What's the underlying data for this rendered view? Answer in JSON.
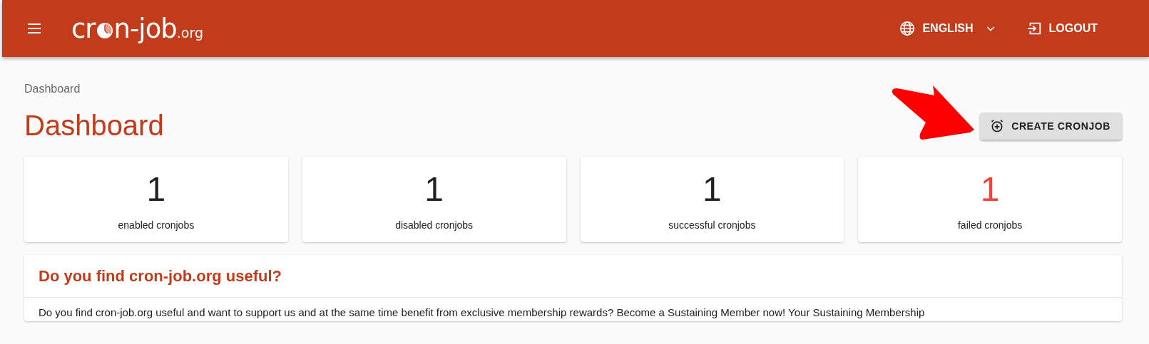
{
  "header": {
    "logo": {
      "main": "cr",
      "rest": "n-job",
      "suffix": ".org"
    },
    "language": "ENGLISH",
    "logout": "LOGOUT"
  },
  "breadcrumb": "Dashboard",
  "title": "Dashboard",
  "create_button": "CREATE CRONJOB",
  "stats": [
    {
      "value": "1",
      "label": "enabled cronjobs",
      "color": "#212121"
    },
    {
      "value": "1",
      "label": "disabled cronjobs",
      "color": "#212121"
    },
    {
      "value": "1",
      "label": "successful cronjobs",
      "color": "#212121"
    },
    {
      "value": "1",
      "label": "failed cronjobs",
      "color": "#f44336"
    }
  ],
  "promo": {
    "title": "Do you find cron-job.org useful?",
    "text": "Do you find cron-job.org useful and want to support us and at the same time benefit from exclusive membership rewards? Become a Sustaining Member now! Your Sustaining Membership"
  }
}
